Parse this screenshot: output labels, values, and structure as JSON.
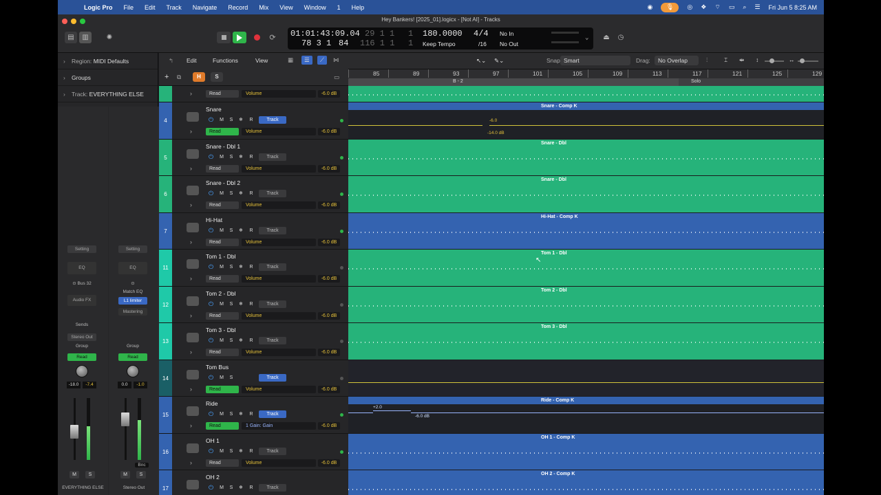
{
  "menubar": {
    "app": "Logic Pro",
    "items": [
      "File",
      "Edit",
      "Track",
      "Navigate",
      "Record",
      "Mix",
      "View",
      "Window",
      "1",
      "Help"
    ],
    "datetime": "Fri Jun 5  8:25 AM"
  },
  "window": {
    "title": "Hey Bankers! [2025_01].logicx - [Not AI] - Tracks"
  },
  "lcd": {
    "time": "01:01:43:09.04",
    "bars_top": "29  1  1",
    "bars_top_sub": "1",
    "tempo": "180.0000",
    "signature": "4/4",
    "in_label": "No In",
    "pos": "78  3  1",
    "pos_ticks": "84",
    "bars_bottom": "116  1  1",
    "bars_bottom_sub": "1",
    "tempo_mode": "Keep Tempo",
    "division": "/16",
    "out_label": "No Out"
  },
  "inspector": {
    "region_label": "Region:",
    "region_value": "MIDI Defaults",
    "groups": "Groups",
    "track_label": "Track:",
    "track_value": "EVERYTHING ELSE",
    "strip1": {
      "setting": "Setting",
      "eq": "EQ",
      "bus": "Bus 32",
      "audio_fx": "Audio FX",
      "sends": "Sends",
      "output": "Stereo Out",
      "group": "Group",
      "automation": "Read",
      "pan_value": "-18.0",
      "gain_value": "-7.4",
      "mute": "M",
      "solo": "S",
      "name": "EVERYTHING ELSE",
      "fader_level": 0.45,
      "meter_level": 0.55
    },
    "strip2": {
      "setting": "Setting",
      "eq": "EQ",
      "insert1": "Match EQ",
      "insert2": "L1 limiter",
      "insert3": "Mastering",
      "group": "Group",
      "automation": "Read",
      "pan_value": "0.0",
      "gain_value": "-1.0",
      "bnc": "Bnc",
      "mute": "M",
      "solo": "S",
      "name": "Stereo Out",
      "fader_level": 0.7,
      "meter_level": 0.65
    }
  },
  "track_toolbar": {
    "edit": "Edit",
    "functions": "Functions",
    "view": "View",
    "h": "H",
    "s": "S"
  },
  "arrange_toolbar": {
    "snap_label": "Snap:",
    "snap_value": "Smart",
    "drag_label": "Drag:",
    "drag_value": "No Overlap"
  },
  "ruler": {
    "bars": [
      "85",
      "89",
      "93",
      "97",
      "101",
      "105",
      "109",
      "113",
      "117",
      "121",
      "125",
      "129"
    ],
    "marker1": "B - 2",
    "marker2": "Solo"
  },
  "tracks": [
    {
      "num": "",
      "name": "",
      "param": "Volume",
      "db": "-6.0 dB",
      "read": "Read",
      "read_on": false,
      "color": "#26b37a"
    },
    {
      "num": "4",
      "name": "Snare",
      "param": "Volume",
      "db": "-6.0 dB",
      "read": "Read",
      "read_on": true,
      "track_btn": "Track",
      "track_on": true,
      "dot": "#2fb54a",
      "color": "#3463b0"
    },
    {
      "num": "5",
      "name": "Snare - Dbl 1",
      "param": "Volume",
      "db": "-6.0 dB",
      "read": "Read",
      "read_on": false,
      "track_btn": "Track",
      "track_on": false,
      "dot": "#2fb54a",
      "color": "#26b37a"
    },
    {
      "num": "6",
      "name": "Snare - Dbl 2",
      "param": "Volume",
      "db": "-6.0 dB",
      "read": "Read",
      "read_on": false,
      "track_btn": "Track",
      "track_on": false,
      "dot": "#2fb54a",
      "color": "#26b37a"
    },
    {
      "num": "7",
      "name": "Hi-Hat",
      "param": "Volume",
      "db": "-6.0 dB",
      "read": "Read",
      "read_on": false,
      "track_btn": "Track",
      "track_on": false,
      "dot": "#2fb54a",
      "color": "#3463b0"
    },
    {
      "num": "11",
      "name": "Tom 1 - Dbl",
      "param": "Volume",
      "db": "-6.0 dB",
      "read": "Read",
      "read_on": false,
      "track_btn": "Track",
      "track_on": false,
      "dot": "#555",
      "color": "#1fc9a8"
    },
    {
      "num": "12",
      "name": "Tom 2 - Dbl",
      "param": "Volume",
      "db": "-6.0 dB",
      "read": "Read",
      "read_on": false,
      "track_btn": "Track",
      "track_on": false,
      "dot": "#555",
      "color": "#1fc9a8"
    },
    {
      "num": "13",
      "name": "Tom 3 - Dbl",
      "param": "Volume",
      "db": "-6.0 dB",
      "read": "Read",
      "read_on": false,
      "track_btn": "Track",
      "track_on": false,
      "dot": "#555",
      "color": "#1fc9a8"
    },
    {
      "num": "14",
      "name": "Tom Bus",
      "param": "Volume",
      "db": "-6.0 dB",
      "read": "Read",
      "read_on": true,
      "track_btn": "Track",
      "track_on": true,
      "dot": "#555",
      "color": "#1a5f66"
    },
    {
      "num": "15",
      "name": "Ride",
      "param": "1 Gain: Gain",
      "db": "-6.0 dB",
      "read": "Read",
      "read_on": true,
      "track_btn": "Track",
      "track_on": true,
      "dot": "#2fb54a",
      "color": "#3463b0"
    },
    {
      "num": "16",
      "name": "OH 1",
      "param": "Volume",
      "db": "-6.0 dB",
      "read": "Read",
      "read_on": false,
      "track_btn": "Track",
      "track_on": false,
      "dot": "#2fb54a",
      "color": "#3463b0"
    },
    {
      "num": "17",
      "name": "OH 2",
      "param": "",
      "db": "",
      "read": "",
      "read_on": false,
      "track_btn": "Track",
      "track_on": false,
      "dot": "",
      "color": "#3463b0"
    }
  ],
  "regions": [
    {
      "name": "",
      "style": "green"
    },
    {
      "name": "Snare - Comp K",
      "style": "blue",
      "auto": true,
      "auto_val1": "-6.0",
      "auto_val2": "-14.0 dB"
    },
    {
      "name": "Snare - Dbl",
      "style": "green"
    },
    {
      "name": "Snare - Dbl",
      "style": "green"
    },
    {
      "name": "Hi-Hat - Comp K",
      "style": "blue"
    },
    {
      "name": "Tom 1 - Dbl",
      "style": "green"
    },
    {
      "name": "Tom 2 - Dbl",
      "style": "green"
    },
    {
      "name": "Tom 3 - Dbl",
      "style": "green"
    },
    {
      "name": "",
      "style": "dark"
    },
    {
      "name": "Ride - Comp K",
      "style": "blue",
      "auto": true,
      "auto_val1": "+2.0",
      "auto_val2": "-6.0 dB"
    },
    {
      "name": "OH 1 - Comp K",
      "style": "blue"
    },
    {
      "name": "OH 2 - Comp K",
      "style": "blue"
    }
  ]
}
